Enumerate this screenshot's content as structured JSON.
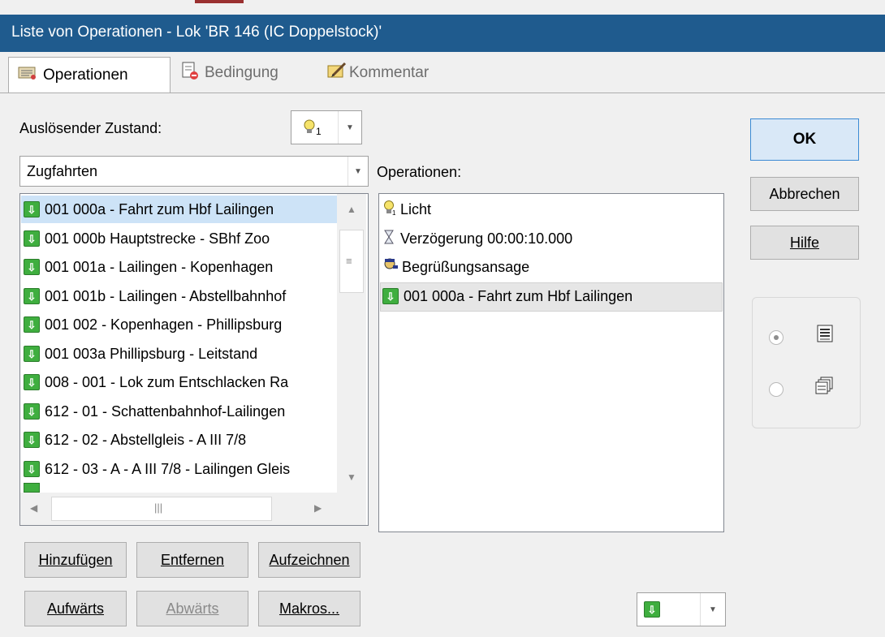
{
  "window": {
    "title": "Liste von Operationen - Lok 'BR 146 (IC Doppelstock)'"
  },
  "tabs": [
    {
      "label": "Operationen",
      "icon": "operations-icon"
    },
    {
      "label": "Bedingung",
      "icon": "condition-icon"
    },
    {
      "label": "Kommentar",
      "icon": "comment-icon"
    }
  ],
  "trigger": {
    "label": "Auslösender Zustand:",
    "state_value": "1",
    "category": "Zugfahrten"
  },
  "routes": [
    "001 000a - Fahrt zum Hbf Lailingen",
    "001 000b Hauptstrecke - SBhf Zoo",
    "001 001a - Lailingen - Kopenhagen",
    "001 001b - Lailingen - Abstellbahnhof",
    "001 002 - Kopenhagen - Phillipsburg",
    "001 003a Phillipsburg - Leitstand",
    "008 - 001 - Lok zum Entschlacken Ra",
    "612 - 01 - Schattenbahnhof-Lailingen",
    "612 - 02 - Abstellgleis - A III 7/8",
    "612 - 03 - A - A III 7/8 - Lailingen Gleis"
  ],
  "operations": {
    "label": "Operationen:",
    "items": [
      {
        "text": "Licht",
        "icon": "light-bulb-icon"
      },
      {
        "text": "Verzögerung 00:00:10.000",
        "icon": "hourglass-icon"
      },
      {
        "text": "Begrüßungsansage",
        "icon": "announcer-icon"
      },
      {
        "text": "001 000a - Fahrt zum Hbf Lailingen",
        "icon": "route-icon"
      }
    ]
  },
  "buttons": {
    "ok": "OK",
    "cancel": "Abbrechen",
    "help": "Hilfe",
    "add": "Hinzufügen",
    "remove": "Entfernen",
    "record": "Aufzeichnen",
    "up": "Aufwärts",
    "down": "Abwärts",
    "macros": "Makros..."
  },
  "colors": {
    "titlebar": "#1f5b8e",
    "route_icon": "#3fae3f",
    "selection": "#cde3f7"
  }
}
